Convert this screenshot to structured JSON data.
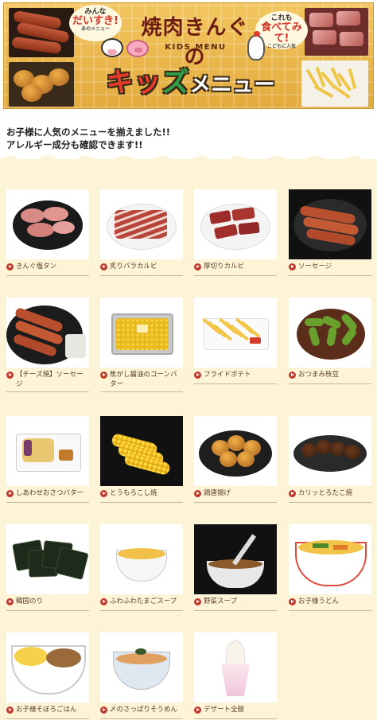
{
  "banner": {
    "bubble_left": {
      "top": "みんな",
      "mid": "だいすき!",
      "bot": "あのメニュー"
    },
    "bubble_right": {
      "top": "これも",
      "mid": "食べてみて!",
      "bot": "こどもに人気"
    },
    "logo": "焼肉きんぐの",
    "kids_menu_en": "KIDS MENU",
    "title_ki": "キ",
    "title_ssu": "ッ",
    "title_zu": "ズ",
    "title_menu": "メニュー"
  },
  "intro": {
    "line1": "お子様に人気のメニューを揃えました!!",
    "line2": "アレルギー成分も確認できます!!"
  },
  "menu": {
    "items": [
      {
        "label": "きんぐ塩タン",
        "icon": "beef-tongue-photo"
      },
      {
        "label": "炙りバラカルビ",
        "icon": "beef-belly-photo"
      },
      {
        "label": "厚切りカルビ",
        "icon": "thick-kalbi-photo"
      },
      {
        "label": "ソーセージ",
        "icon": "sausage-photo"
      },
      {
        "label": "【チーズ焼】ソーセージ",
        "icon": "cheese-sausage-photo"
      },
      {
        "label": "焦がし醤油のコーンバター",
        "icon": "corn-butter-photo"
      },
      {
        "label": "フライドポテト",
        "icon": "french-fries-photo"
      },
      {
        "label": "おつまみ枝豆",
        "icon": "edamame-photo"
      },
      {
        "label": "しあわせおさつバター",
        "icon": "sweet-potato-photo"
      },
      {
        "label": "とうもろこし焼",
        "icon": "grilled-corn-photo"
      },
      {
        "label": "鶏唐揚げ",
        "icon": "fried-chicken-photo"
      },
      {
        "label": "カリッとろたこ焼",
        "icon": "takoyaki-photo"
      },
      {
        "label": "韓国のり",
        "icon": "korean-seaweed-photo"
      },
      {
        "label": "ふわふわたまごスープ",
        "icon": "egg-soup-photo"
      },
      {
        "label": "野菜スープ",
        "icon": "vegetable-soup-photo"
      },
      {
        "label": "お子様うどん",
        "icon": "udon-photo"
      },
      {
        "label": "お子様そぼろごはん",
        "icon": "soboro-rice-photo"
      },
      {
        "label": "〆のさっぱりそうめん",
        "icon": "somen-photo"
      },
      {
        "label": "デザート全般",
        "icon": "dessert-photo"
      }
    ]
  }
}
